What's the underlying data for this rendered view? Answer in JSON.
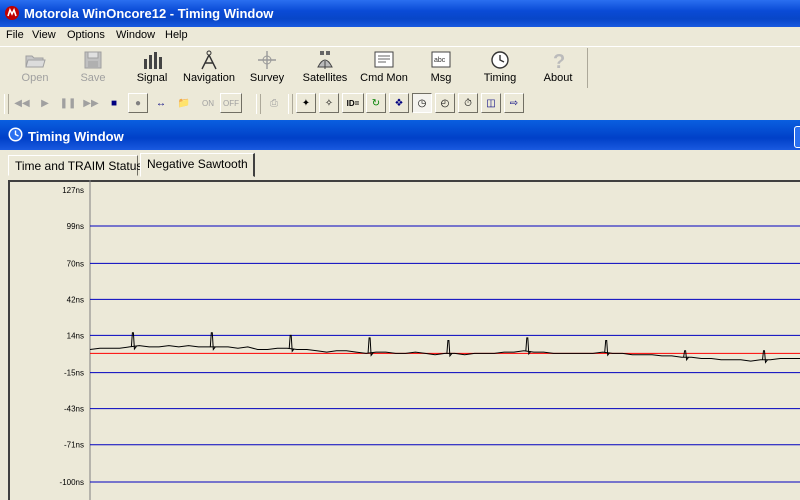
{
  "app": {
    "title": "Motorola WinOncore12 - Timing Window"
  },
  "menu": [
    "File",
    "View",
    "Options",
    "Window",
    "Help"
  ],
  "toolbar": {
    "open": "Open",
    "save": "Save",
    "signal": "Signal",
    "navigation": "Navigation",
    "survey": "Survey",
    "satellites": "Satellites",
    "cmd_mon": "Cmd Mon",
    "msg": "Msg",
    "timing": "Timing",
    "about": "About",
    "msg_icon_text": "abc"
  },
  "toolbar2": {
    "on_label": "ON",
    "off_label": "OFF",
    "id_label": "ID="
  },
  "child_window": {
    "title": "Timing Window"
  },
  "tabs": [
    {
      "label": "Time and TRAIM Status",
      "active": false
    },
    {
      "label": "Negative Sawtooth",
      "active": true
    }
  ],
  "colors": {
    "grid": "#0000c0",
    "zero_line": "#ff0000",
    "trace": "#000000"
  },
  "chart_data": {
    "type": "line",
    "title": "",
    "xlabel": "",
    "ylabel": "",
    "y_ticks": [
      "127ns",
      "99ns",
      "70ns",
      "42ns",
      "14ns",
      "-15ns",
      "-43ns",
      "-71ns",
      "-100ns"
    ],
    "y_tick_values": [
      127,
      99,
      70,
      42,
      14,
      -15,
      -43,
      -71,
      -100
    ],
    "ylim": [
      -100,
      127
    ],
    "grid": true,
    "reference_line": {
      "y": 0
    },
    "series": [
      {
        "x": [
          0,
          5,
          10,
          15,
          20,
          25,
          30,
          35,
          40,
          45,
          50,
          55,
          60,
          65,
          70,
          75,
          80,
          85,
          90,
          95,
          100,
          105,
          110,
          115,
          120,
          125,
          130,
          135,
          140,
          145,
          150,
          155,
          160,
          165,
          170,
          175,
          180,
          185,
          190,
          195,
          200,
          205,
          210,
          215,
          220,
          225,
          230,
          235,
          240,
          245,
          250,
          255,
          260,
          265,
          270,
          275,
          280,
          285,
          290,
          295,
          300,
          305,
          310,
          315,
          320,
          325,
          330,
          335,
          340,
          345,
          350,
          355,
          360
        ],
        "y": [
          3,
          4,
          4,
          4,
          5,
          6,
          5,
          5,
          6,
          5,
          6,
          5,
          5,
          5,
          5,
          4,
          5,
          3,
          3,
          4,
          4,
          3,
          3,
          2,
          1,
          2,
          2,
          1,
          0,
          1,
          1,
          0,
          0,
          1,
          0,
          -1,
          0,
          0,
          -1,
          0,
          0,
          0,
          1,
          1,
          2,
          1,
          1,
          0,
          0,
          0,
          0,
          0,
          1,
          0,
          0,
          -1,
          -1,
          -1,
          -2,
          -2,
          -3,
          -3,
          -4,
          -4,
          -5,
          -5,
          -5,
          -6,
          -5,
          -5,
          -4,
          -4,
          -4
        ],
        "spikes": [
          {
            "x": 22,
            "y": 16
          },
          {
            "x": 62,
            "y": 16
          },
          {
            "x": 102,
            "y": 14
          },
          {
            "x": 142,
            "y": 12
          },
          {
            "x": 182,
            "y": 10
          },
          {
            "x": 222,
            "y": 12
          },
          {
            "x": 262,
            "y": 10
          },
          {
            "x": 302,
            "y": 2
          },
          {
            "x": 342,
            "y": 2
          }
        ]
      }
    ]
  }
}
